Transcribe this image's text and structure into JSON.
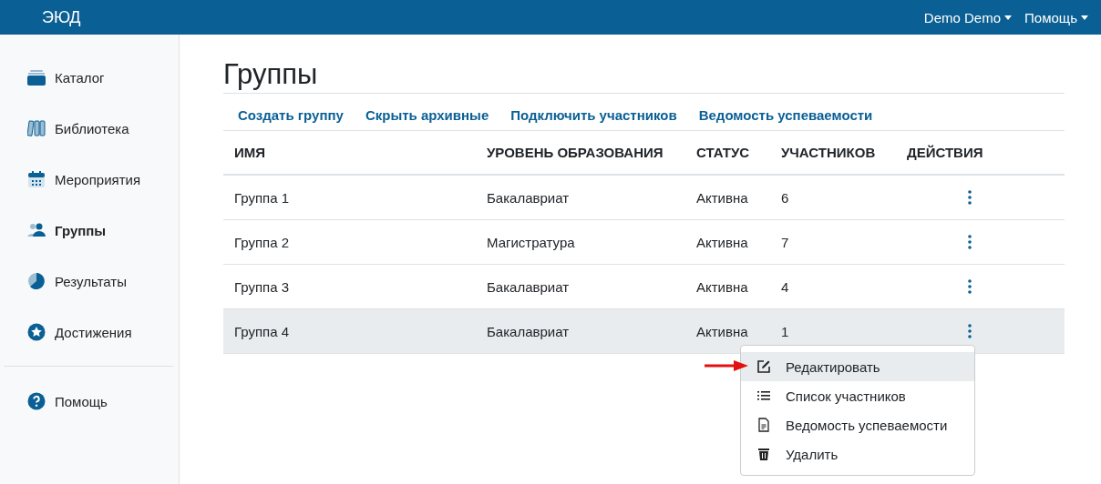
{
  "header": {
    "logo": "ЭЮД",
    "menus": [
      {
        "label": "Demo Demo"
      },
      {
        "label": "Помощь"
      }
    ]
  },
  "sidebar": {
    "items": [
      {
        "label": "Каталог",
        "kind": "catalog",
        "selected": false
      },
      {
        "label": "Библиотека",
        "kind": "library",
        "selected": false
      },
      {
        "label": "Мероприятия",
        "kind": "calendar",
        "selected": false
      },
      {
        "label": "Группы",
        "kind": "users",
        "selected": true
      },
      {
        "label": "Результаты",
        "kind": "pie",
        "selected": false
      },
      {
        "label": "Достижения",
        "kind": "star",
        "selected": false
      }
    ],
    "footer_items": [
      {
        "label": "Помощь",
        "kind": "help",
        "selected": false
      }
    ]
  },
  "page": {
    "title": "Группы",
    "actions": [
      "Создать группу",
      "Скрыть архивные",
      "Подключить участников",
      "Ведомость успеваемости"
    ]
  },
  "table": {
    "columns": [
      "ИМЯ",
      "УРОВЕНЬ ОБРАЗОВАНИЯ",
      "СТАТУС",
      "УЧАСТНИКОВ",
      "ДЕЙСТВИЯ"
    ],
    "rows": [
      {
        "cells": [
          "Группа 1",
          "Бакалавриат",
          "Активна",
          "6"
        ],
        "selected": false
      },
      {
        "cells": [
          "Группа 2",
          "Магистратура",
          "Активна",
          "7"
        ],
        "selected": false
      },
      {
        "cells": [
          "Группа 3",
          "Бакалавриат",
          "Активна",
          "4"
        ],
        "selected": false
      },
      {
        "cells": [
          "Группа 4",
          "Бакалавриат",
          "Активна",
          "1"
        ],
        "selected": true
      }
    ]
  },
  "context_menu": {
    "items": [
      {
        "label": "Редактировать",
        "kind": "edit",
        "selected": true
      },
      {
        "label": "Список участников",
        "kind": "list",
        "selected": false
      },
      {
        "label": "Ведомость успеваемости",
        "kind": "doc",
        "selected": false
      },
      {
        "label": "Удалить",
        "kind": "trash",
        "selected": false
      }
    ]
  }
}
